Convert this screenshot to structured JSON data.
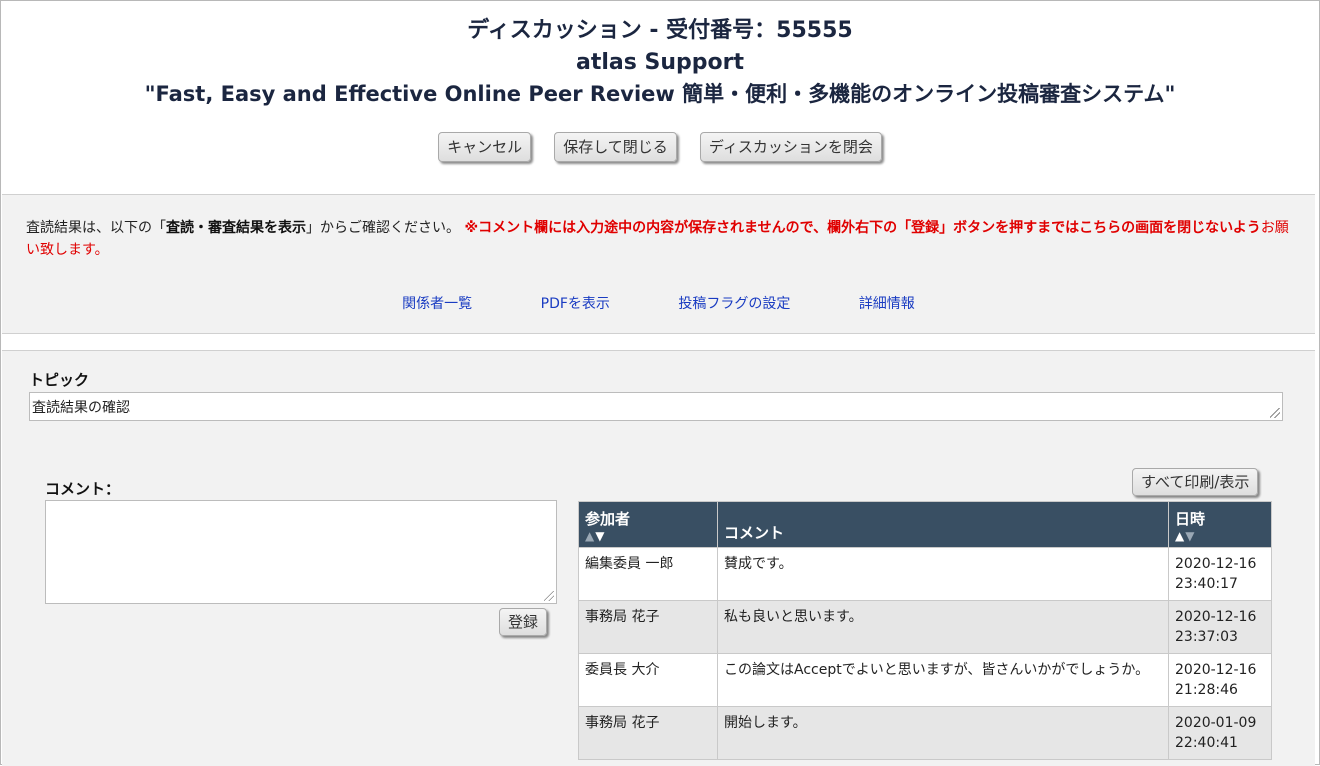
{
  "header": {
    "title": "ディスカッション - 受付番号：55555",
    "site_name": "atlas Support",
    "tagline": "\"Fast, Easy and Effective Online Peer Review 簡単・便利・多機能のオンライン投稿審査システム\""
  },
  "buttons": {
    "cancel": "キャンセル",
    "save_close": "保存して閉じる",
    "close_discussion": "ディスカッションを閉会",
    "submit": "登録",
    "print_all": "すべて印刷/表示"
  },
  "notice": {
    "part1": "査読結果は、以下の「",
    "bold_link": "査読・審査結果を表示",
    "part2": "」からご確認ください。 ",
    "red_bold": "※コメント欄には入力途中の内容が保存されませんので、欄外右下の「登録」ボタンを押すまではこちらの画面を閉じないよう",
    "red_normal": "お願い致します。"
  },
  "links": {
    "participants": "関係者一覧",
    "view_pdf": "PDFを表示",
    "flag_settings": "投稿フラグの設定",
    "details": "詳細情報"
  },
  "topic": {
    "label": "トピック",
    "value": "査読結果の確認"
  },
  "comment": {
    "label": "コメント：",
    "value": ""
  },
  "table": {
    "headers": {
      "participant": "参加者",
      "comment": "コメント",
      "datetime": "日時"
    },
    "rows": [
      {
        "participant": "編集委員 一郎",
        "comment": "賛成です。",
        "date": "2020-12-16",
        "time": "23:40:17"
      },
      {
        "participant": "事務局 花子",
        "comment": "私も良いと思います。",
        "date": "2020-12-16",
        "time": "23:37:03"
      },
      {
        "participant": "委員長 大介",
        "comment": "この論文はAcceptでよいと思いますが、皆さんいかがでしょうか。",
        "date": "2020-12-16",
        "time": "21:28:46"
      },
      {
        "participant": "事務局 花子",
        "comment": "開始します。",
        "date": "2020-01-09",
        "time": "22:40:41"
      }
    ]
  },
  "colors": {
    "title": "#1b2640",
    "table_header": "#394f63",
    "link": "#1a3cc2",
    "warning": "#e00000"
  }
}
